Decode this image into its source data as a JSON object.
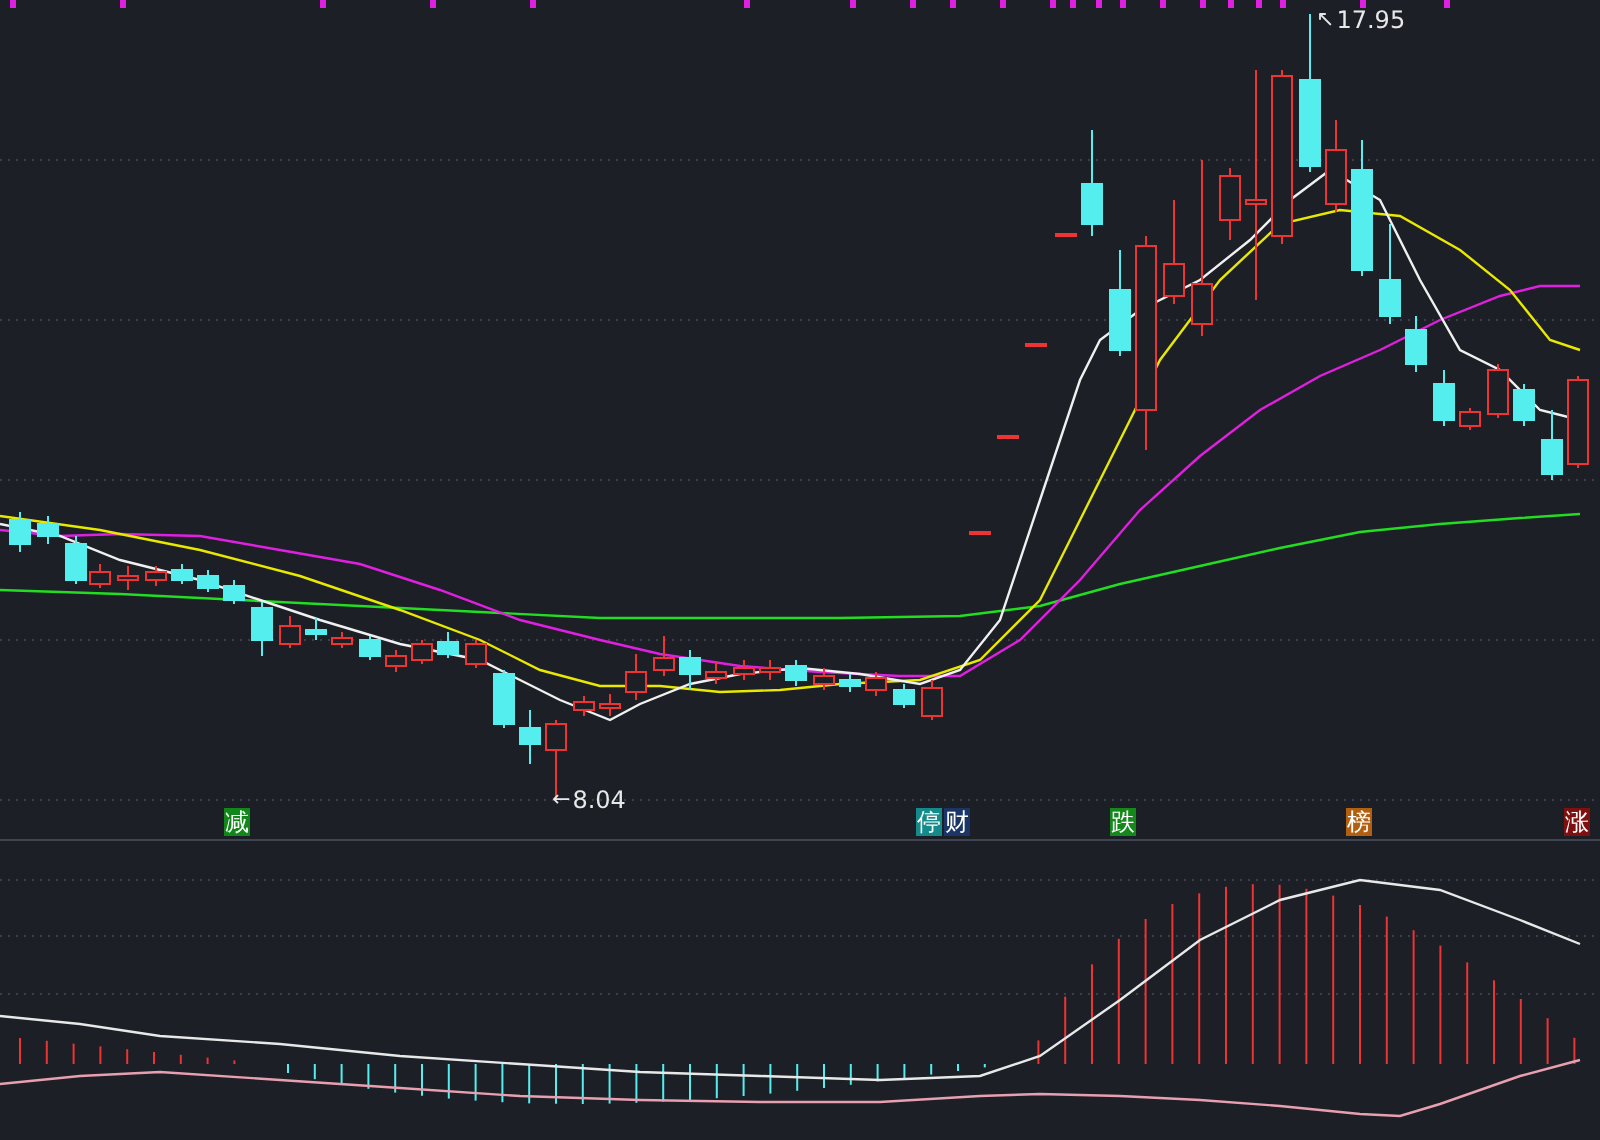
{
  "price_chart": {
    "high_label": {
      "arrow": "↖",
      "text": "17.95"
    },
    "low_label": {
      "arrow": "←",
      "text": "8.04"
    }
  },
  "signals": [
    {
      "text": "减",
      "color": "#11871a"
    },
    {
      "text": "停",
      "color": "#148a8a"
    },
    {
      "text": "财",
      "color": "#1b3566"
    },
    {
      "text": "跌",
      "color": "#12891a"
    },
    {
      "text": "榜",
      "color": "#b2600f"
    },
    {
      "text": "涨",
      "color": "#7e1010"
    }
  ]
}
